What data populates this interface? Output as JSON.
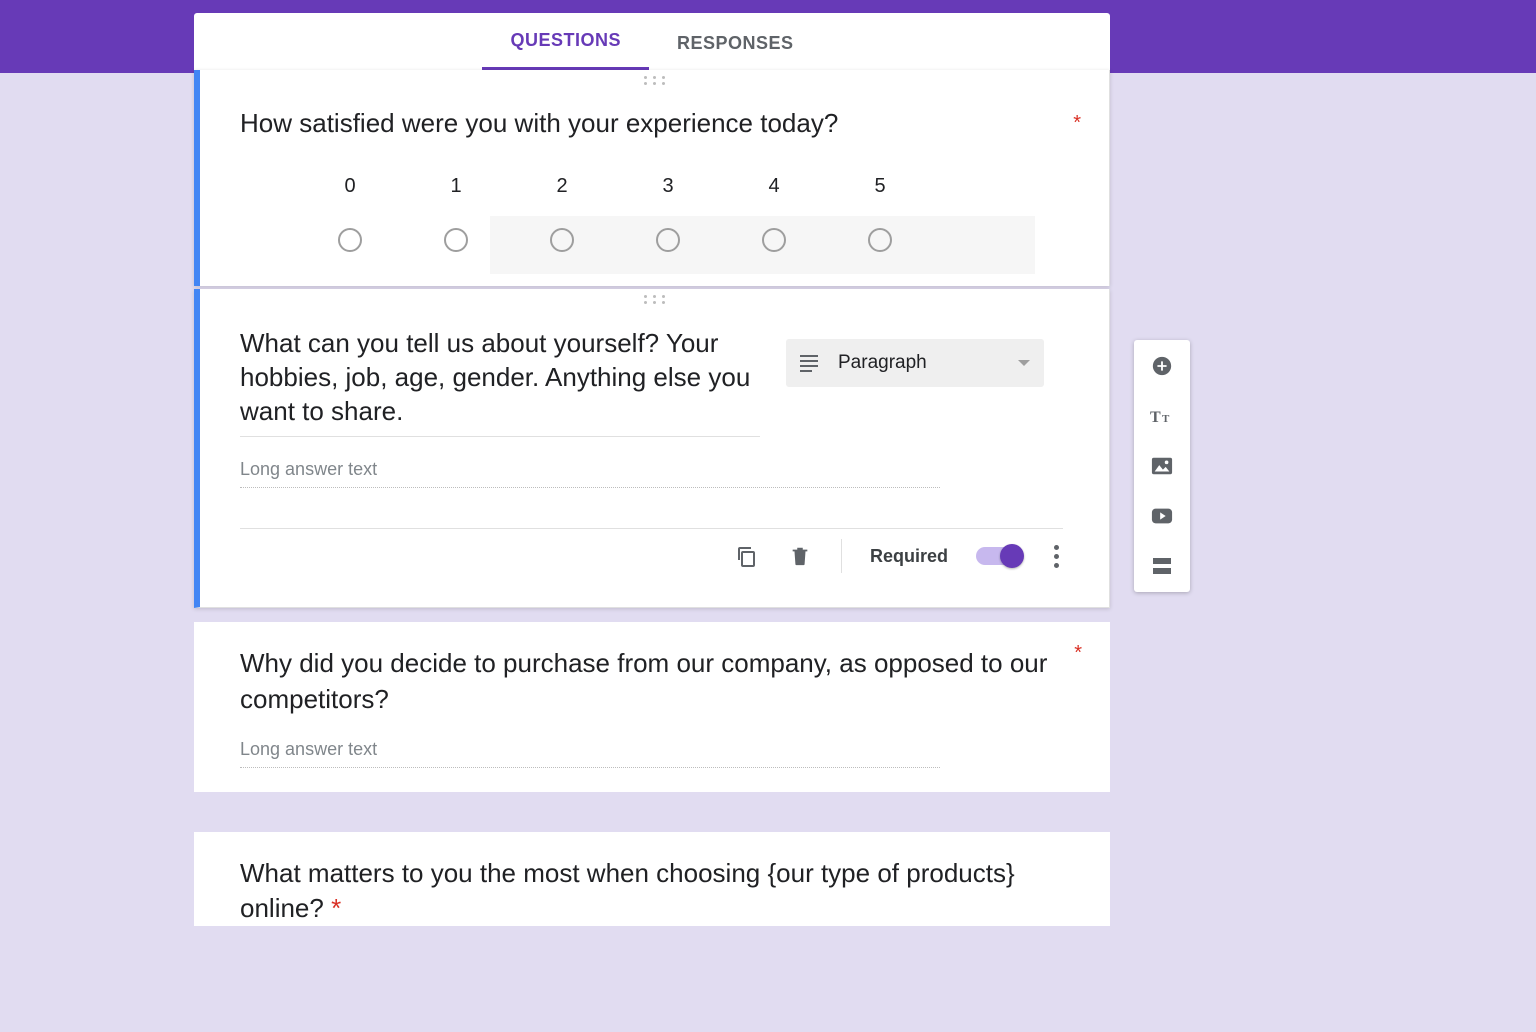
{
  "tabs": {
    "questions": "QUESTIONS",
    "responses": "RESPONSES"
  },
  "q1": {
    "title": "How satisfied were you with your experience today?",
    "scale": {
      "labels": [
        "0",
        "1",
        "2",
        "3",
        "4",
        "5"
      ]
    }
  },
  "q2": {
    "title": "What can you tell us about yourself? Your hobbies, job, age, gender. Anything else you want to share.",
    "placeholder": "Long answer text",
    "type_label": "Paragraph",
    "required_label": "Required"
  },
  "q3": {
    "title": "Why did you decide to purchase from our company, as opposed to our competitors?",
    "placeholder": "Long answer text"
  },
  "q4": {
    "title": "What matters to you the most when choosing {our type of products} online?"
  }
}
